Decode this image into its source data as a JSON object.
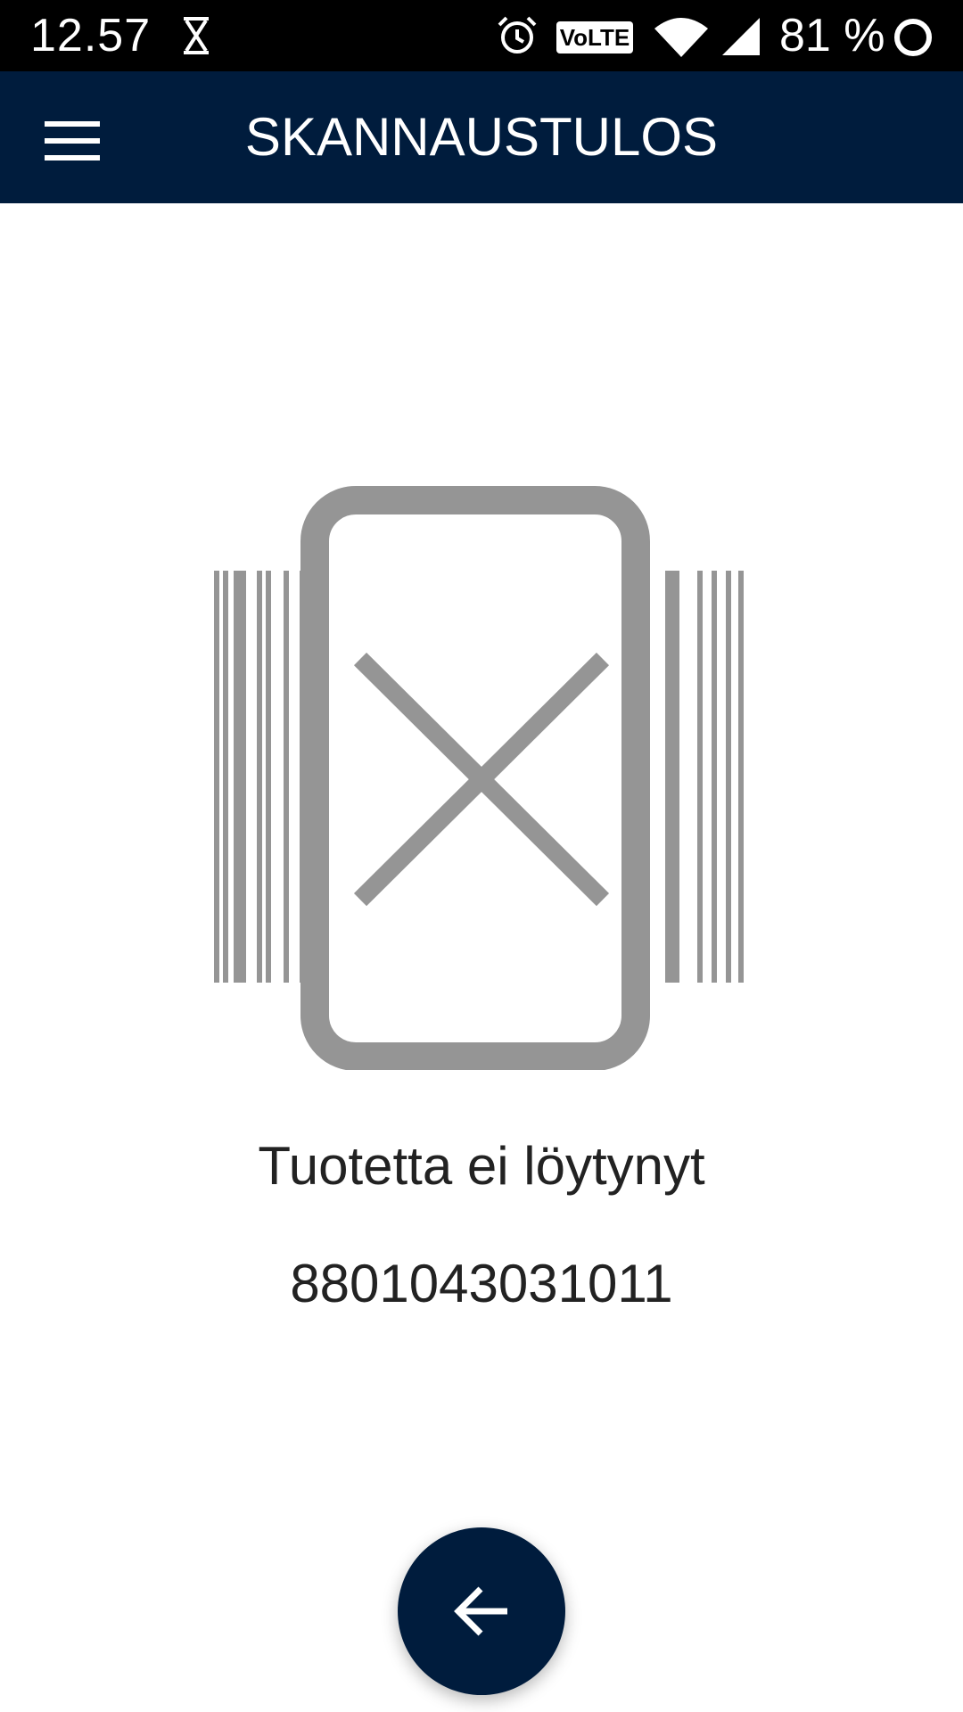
{
  "status_bar": {
    "time": "12.57",
    "battery": "81 %",
    "network_badge": "VoLTE",
    "icons": [
      "hourglass-icon",
      "alarm-icon",
      "volte-icon",
      "wifi-icon",
      "signal-icon",
      "battery-ring-icon"
    ]
  },
  "app_bar": {
    "title": "SKANNAUSTULOS",
    "menu_icon": "menu-icon"
  },
  "result": {
    "illustration_icon": "product-not-found-icon",
    "message": "Tuotetta ei löytynyt",
    "barcode": "8801043031011"
  },
  "fab": {
    "icon": "arrow-back-icon"
  },
  "colors": {
    "primary": "#001c3d",
    "illustration_gray": "#959595",
    "text": "#222222"
  }
}
